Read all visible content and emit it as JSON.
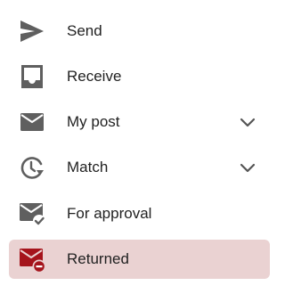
{
  "menu": {
    "items": [
      {
        "label": "Send",
        "icon": "send-icon",
        "has_chevron": false,
        "active": false
      },
      {
        "label": "Receive",
        "icon": "inbox-icon",
        "has_chevron": false,
        "active": false
      },
      {
        "label": "My post",
        "icon": "mail-icon",
        "has_chevron": true,
        "active": false
      },
      {
        "label": "Match",
        "icon": "clock-arrow-icon",
        "has_chevron": true,
        "active": false
      },
      {
        "label": "For approval",
        "icon": "mail-check-icon",
        "has_chevron": false,
        "active": false
      },
      {
        "label": "Returned",
        "icon": "mail-minus-icon",
        "has_chevron": false,
        "active": true
      }
    ]
  },
  "colors": {
    "icon_gray": "#5f5f5f",
    "active_icon": "#a5141c",
    "active_background": "#ead2d2",
    "chevron": "#555555",
    "text": "#222222"
  }
}
